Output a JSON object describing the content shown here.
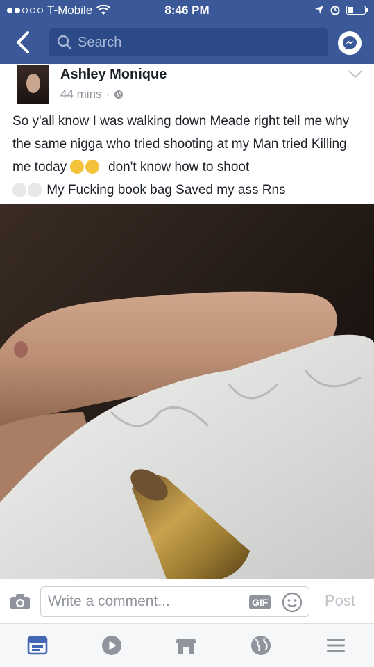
{
  "status_bar": {
    "carrier": "T-Mobile",
    "time": "8:46 PM"
  },
  "search": {
    "placeholder": "Search"
  },
  "post": {
    "author": "Ashley Monique",
    "time_ago": "44 mins",
    "separator": "·",
    "text_part1": "So y'all know I was walking down Meade right tell me why the same nigga who tried shooting at my Man tried Killing me today",
    "text_part2": "don't know how to shoot",
    "text_part3": "My Fucking book bag Saved my ass Rns"
  },
  "comment": {
    "placeholder": "Write a comment...",
    "gif_label": "GIF",
    "post_label": "Post"
  },
  "colors": {
    "brand": "#3b5998",
    "tab_active": "#4267b2",
    "tab_inactive": "#90949c"
  },
  "icons": {
    "back": "chevron-left-icon",
    "messenger": "messenger-icon",
    "globe": "globe-icon",
    "camera": "camera-icon",
    "smiley": "smiley-icon"
  }
}
